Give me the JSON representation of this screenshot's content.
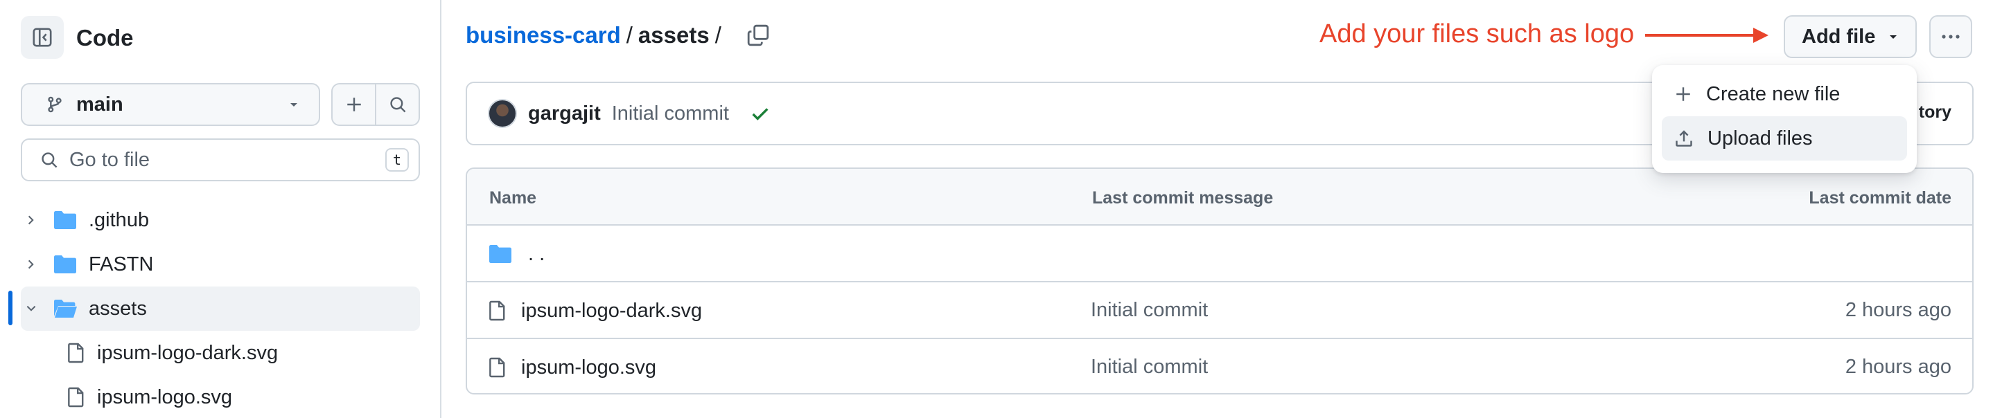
{
  "sidebar": {
    "title": "Code",
    "branch": "main",
    "search_placeholder": "Go to file",
    "search_shortcut": "t",
    "tree": [
      {
        "label": ".github",
        "type": "folder",
        "expanded": false
      },
      {
        "label": "FASTN",
        "type": "folder",
        "expanded": false
      },
      {
        "label": "assets",
        "type": "folder",
        "expanded": true,
        "active": true
      },
      {
        "label": "ipsum-logo-dark.svg",
        "type": "file"
      },
      {
        "label": "ipsum-logo.svg",
        "type": "file"
      }
    ]
  },
  "breadcrumb": {
    "repo": "business-card",
    "sep1": "/",
    "folder": "assets",
    "sep2": "/"
  },
  "annotation": {
    "text": "Add your files such as logo",
    "color": "#e8442b"
  },
  "toolbar": {
    "add_file_label": "Add file"
  },
  "dropdown": {
    "items": [
      {
        "label": "Create new file",
        "icon": "plus-icon"
      },
      {
        "label": "Upload files",
        "icon": "upload-icon"
      }
    ]
  },
  "commit": {
    "author": "gargajit",
    "message": "Initial commit",
    "history_label": "tory"
  },
  "table": {
    "headers": {
      "name": "Name",
      "message": "Last commit message",
      "date": "Last commit date"
    },
    "parent_label": ". .",
    "rows": [
      {
        "name": "ipsum-logo-dark.svg",
        "message": "Initial commit",
        "date": "2 hours ago"
      },
      {
        "name": "ipsum-logo.svg",
        "message": "Initial commit",
        "date": "2 hours ago"
      }
    ]
  },
  "colors": {
    "accent": "#0969da",
    "folder": "#54aeff",
    "success": "#1a7f37"
  }
}
